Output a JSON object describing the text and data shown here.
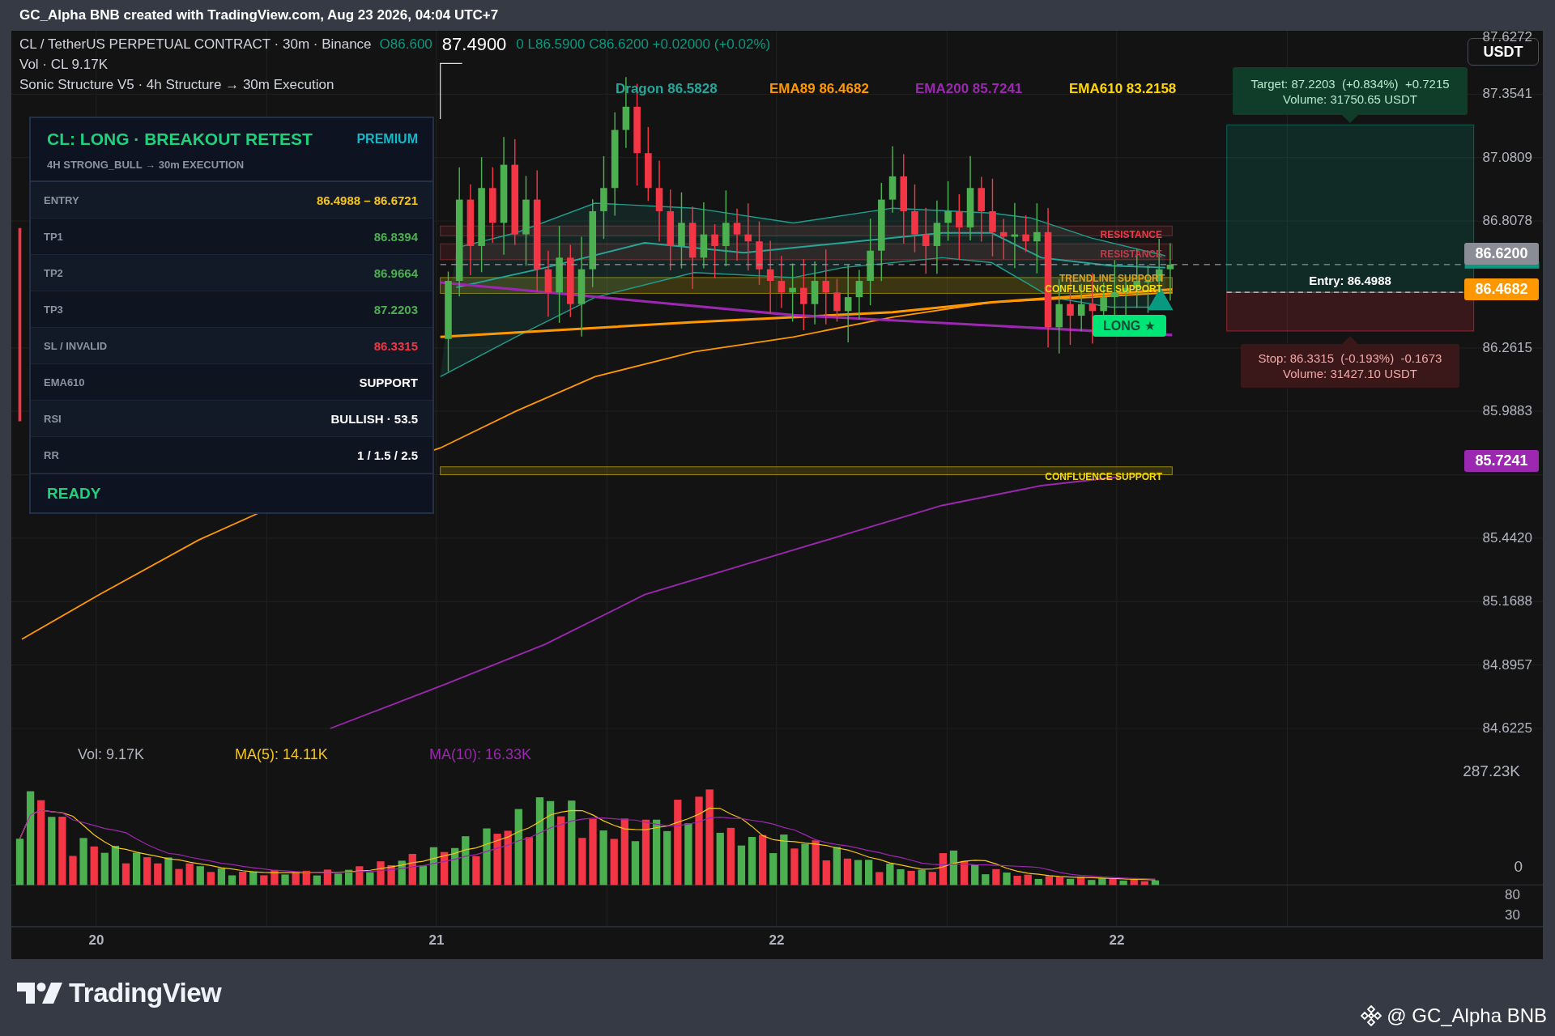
{
  "header": {
    "title": "GC_Alpha BNB created with TradingView.com, Aug 23 2026, 04:04 UTC+7"
  },
  "legend": {
    "symbol": "CL / TetherUS PERPETUAL CONTRACT · 30m · Binance",
    "ohlc_start": "O86.600",
    "crosshair_price": "87.4900",
    "ohlc_end": "0 L86.5900 C86.6200 +0.02000 (+0.02%)",
    "volume": "Vol · CL  9.17K",
    "indicator": "Sonic Structure V5 · 4h Structure → 30m Execution"
  },
  "currency_button": "USDT",
  "ma_labels": [
    {
      "text": "Dragon 86.5828",
      "color": "#26a69a"
    },
    {
      "text": "EMA89 86.4682",
      "color": "#ff9800"
    },
    {
      "text": "EMA200 85.7241",
      "color": "#9c27b0"
    },
    {
      "text": "EMA610 83.2158",
      "color": "#ffd600"
    }
  ],
  "signal_card": {
    "title": "CL: LONG · BREAKOUT RETEST",
    "tier": "PREMIUM",
    "subtitle": "4H STRONG_BULL → 30m EXECUTION",
    "rows": [
      {
        "label": "ENTRY",
        "value": "86.4988 – 86.6721",
        "color": "#f5c518"
      },
      {
        "label": "TP1",
        "value": "86.8394",
        "color": "#4caf50"
      },
      {
        "label": "TP2",
        "value": "86.9664",
        "color": "#4caf50"
      },
      {
        "label": "TP3",
        "value": "87.2203",
        "color": "#4caf50"
      },
      {
        "label": "SL / INVALID",
        "value": "86.3315",
        "color": "#f23645"
      },
      {
        "label": "EMA610",
        "value": "SUPPORT",
        "color": "#ffffff"
      },
      {
        "label": "RSI",
        "value": "BULLISH · 53.5",
        "color": "#ffffff"
      },
      {
        "label": "RR",
        "value": "1 / 1.5 / 2.5",
        "color": "#ffffff"
      }
    ],
    "status": "READY"
  },
  "zones": [
    {
      "label": "RESISTANCE",
      "kind": "resistance"
    },
    {
      "label": "RESISTANCE",
      "kind": "resistance_faded"
    },
    {
      "label": "TRENDLINE SUPPORT",
      "kind": "trendline"
    },
    {
      "label": "CONFLUENCE SUPPORT",
      "kind": "confluence"
    },
    {
      "label": "CONFLUENCE SUPPORT",
      "kind": "confluence"
    }
  ],
  "signal_badge": "LONG ★",
  "position": {
    "target": "Target: 87.2203  (+0.834%)  +0.7215",
    "target_volume": "Volume: 31750.65 USDT",
    "entry": "Entry: 86.4988",
    "stop": "Stop: 86.3315  (-0.193%)  -0.1673",
    "stop_volume": "Volume: 31427.10 USDT"
  },
  "price_axis": {
    "ticks": [
      "87.6272",
      "87.3541",
      "87.0809",
      "86.8078",
      "86.2615",
      "85.9883",
      "85.4420",
      "85.1688",
      "84.8957",
      "84.6225"
    ],
    "badges": [
      {
        "value": "86.6200",
        "color": "#8a8d96"
      },
      {
        "value": "86.4682",
        "color": "#ff9800"
      },
      {
        "value": "85.7241",
        "color": "#9c27b0"
      }
    ]
  },
  "volume_pane": {
    "legend": [
      {
        "text": "Vol: 9.17K",
        "color": "#b2b5be"
      },
      {
        "text": "MA(5): 14.11K",
        "color": "#f5c518"
      },
      {
        "text": "MA(10): 16.33K",
        "color": "#9c27b0"
      }
    ],
    "axis": [
      "287.23K",
      "0"
    ]
  },
  "oscillator_axis": [
    "80",
    "30"
  ],
  "time_axis": [
    "20",
    "21",
    "22",
    "22"
  ],
  "footer": {
    "logo": "TradingView",
    "credit": "@ GC_Alpha BNB"
  }
}
